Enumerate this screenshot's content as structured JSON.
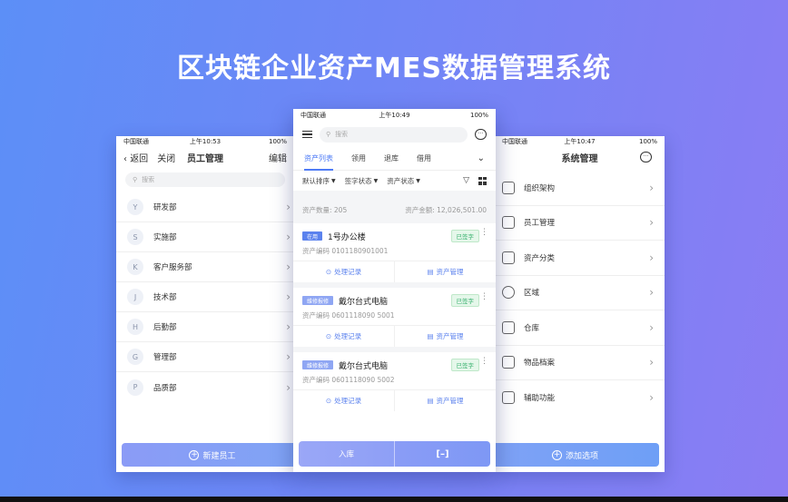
{
  "banner": {
    "title": "区块链企业资产MES数据管理系统",
    "colors": {
      "gradient_start": "#5c8ff7",
      "gradient_end": "#8b7cf3",
      "accent": "#4f7cf6"
    }
  },
  "left_phone": {
    "status": {
      "carrier": "中国联通",
      "time": "上午10:53",
      "battery": "100%"
    },
    "nav": {
      "back": "返回",
      "close": "关闭",
      "title": "员工管理",
      "right": "编辑"
    },
    "search_placeholder": "搜索",
    "departments": [
      {
        "initial": "Y",
        "name": "研发部"
      },
      {
        "initial": "S",
        "name": "实施部"
      },
      {
        "initial": "K",
        "name": "客户服务部"
      },
      {
        "initial": "J",
        "name": "技术部"
      },
      {
        "initial": "H",
        "name": "后勤部"
      },
      {
        "initial": "G",
        "name": "管理部"
      },
      {
        "initial": "P",
        "name": "品质部"
      }
    ],
    "add_button": "新建员工"
  },
  "center_phone": {
    "status": {
      "carrier": "中国联通",
      "time": "上午10:49",
      "battery": "100%"
    },
    "search_placeholder": "搜索",
    "tabs": [
      "资产列表",
      "领用",
      "退库",
      "借用"
    ],
    "filters": [
      "默认排序",
      "签字状态",
      "资产状态"
    ],
    "summary": {
      "count": "资产数量: 205",
      "amount": "资产金额: 12,026,501.00"
    },
    "cards": [
      {
        "status": "在用",
        "status_color": "#5b82ee",
        "name": "1号办公楼",
        "signed": "已签字",
        "code": "资产编码  0101180901001",
        "action1": "处理记录",
        "action2": "资产管理"
      },
      {
        "status": "维修报修",
        "status_color": "#8fa6f3",
        "name": "戴尔台式电脑",
        "signed": "已签字",
        "code": "资产编码  0601118090 5001",
        "action1": "处理记录",
        "action2": "资产管理"
      },
      {
        "status": "维修报修",
        "status_color": "#8fa6f3",
        "name": "戴尔台式电脑",
        "signed": "已签字",
        "code": "资产编码  0601118090 5002",
        "action1": "处理记录",
        "action2": "资产管理"
      }
    ],
    "bottom": {
      "left": "入库",
      "right_icon": "[–]"
    }
  },
  "right_phone": {
    "status": {
      "carrier": "中国联通",
      "time": "上午10:47",
      "battery": "100%"
    },
    "nav": {
      "title": "系统管理"
    },
    "items": [
      {
        "icon": "org-icon",
        "name": "组织架构"
      },
      {
        "icon": "staff-icon",
        "name": "员工管理"
      },
      {
        "icon": "category-icon",
        "name": "资产分类"
      },
      {
        "icon": "region-icon",
        "name": "区域"
      },
      {
        "icon": "warehouse-icon",
        "name": "仓库"
      },
      {
        "icon": "archive-icon",
        "name": "物品档案"
      },
      {
        "icon": "tools-icon",
        "name": "辅助功能"
      }
    ],
    "add_button": "添加选项"
  }
}
